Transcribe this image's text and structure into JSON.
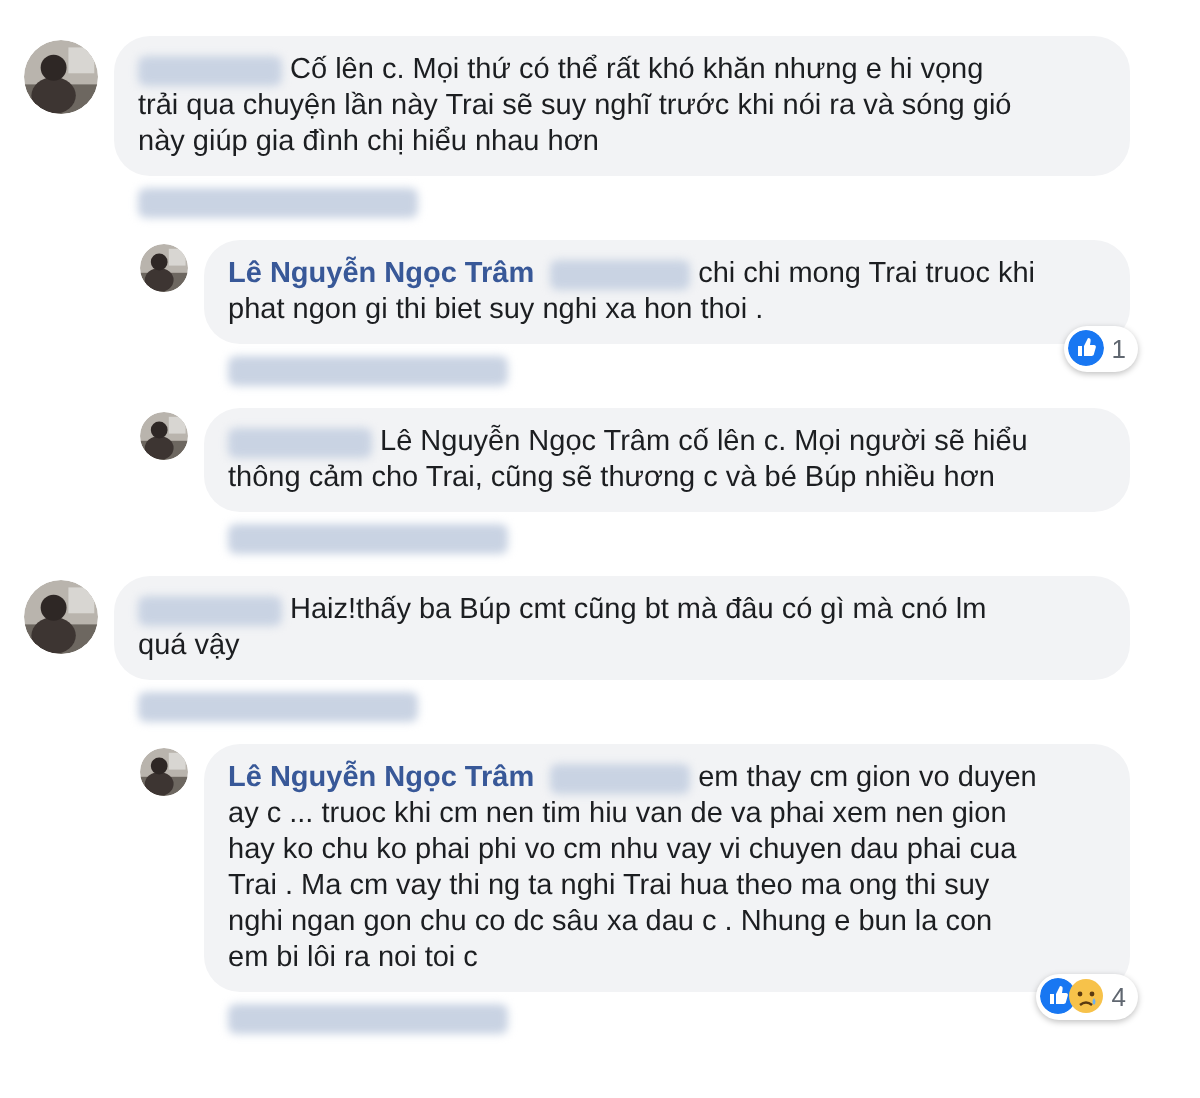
{
  "comments": [
    {
      "avatar": {
        "kind": "picture"
      },
      "text_lines": [
        "Cố lên c. Mọi thứ có thể rất khó khăn nhưng e hi vọng",
        "trải qua chuyện lần này Trai sẽ suy nghĩ trước khi nói ra và sóng gió",
        "này giúp gia đình chị hiểu nhau hơn"
      ],
      "children": [
        {
          "avatar": {
            "kind": "picture"
          },
          "author": "Lê Nguyễn Ngọc Trâm",
          "text_lines": [
            "chi chi mong Trai truoc khi",
            "phat ngon gi thi biet suy nghi xa hon thoi ."
          ],
          "reactions": {
            "icons": [
              {
                "kind": "like"
              }
            ],
            "count": "1"
          }
        },
        {
          "avatar": {
            "kind": "picture"
          },
          "text_lines": [
            "Lê Nguyễn Ngọc Trâm cố lên c. Mọi người sẽ hiểu",
            "thông cảm cho Trai, cũng sẽ thương c và bé Búp nhiều hơn"
          ]
        }
      ]
    },
    {
      "avatar": {
        "kind": "picture"
      },
      "text_lines": [
        "Haiz!thấy ba Búp cmt cũng bt mà đâu có gì mà cnó lm",
        "quá vậy"
      ],
      "children": [
        {
          "avatar": {
            "kind": "picture"
          },
          "author": "Lê Nguyễn Ngọc Trâm",
          "text_lines": [
            "em thay cm gion vo duyen",
            "ay c ... truoc khi cm nen tim hiu van de va phai xem nen gion",
            "hay ko chu ko phai phi vo cm nhu vay vi chuyen dau phai cua",
            "Trai . Ma cm vay thi ng ta nghi Trai hua theo ma ong thi suy",
            "nghi ngan gon chu co dc sâu xa dau c . Nhung e bun la con",
            "em bi lôi ra noi toi c"
          ],
          "reactions": {
            "icons": [
              {
                "kind": "like"
              },
              {
                "kind": "sad"
              }
            ],
            "count": "4"
          }
        }
      ]
    }
  ]
}
